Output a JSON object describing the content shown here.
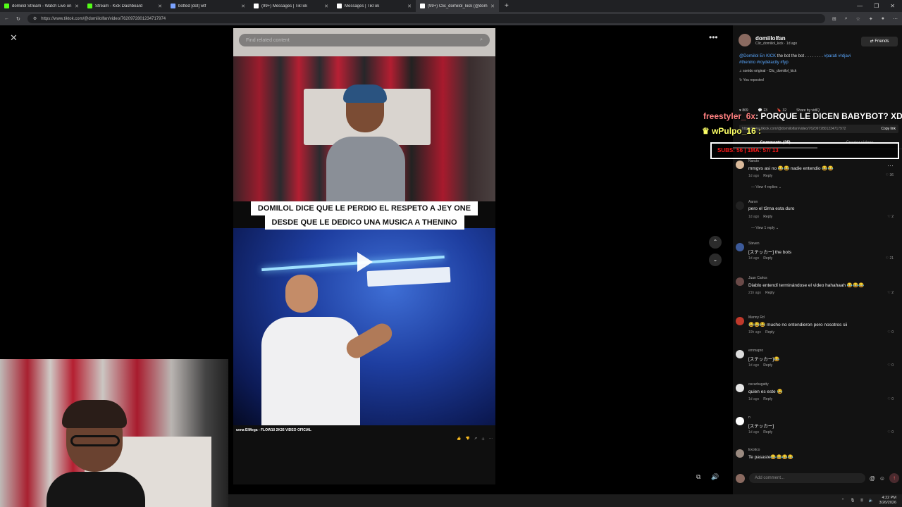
{
  "browser": {
    "tabs": [
      {
        "title": "domiilol Stream - Watch Live on",
        "color": "#53fc18",
        "active": false
      },
      {
        "title": "Stream - Kick Dashboard",
        "color": "#53fc18",
        "active": false
      },
      {
        "title": "botted [dot] wtf",
        "color": "#7aa2ff",
        "active": false
      },
      {
        "title": "(99+) Messages | TikTok",
        "color": "#ffffff",
        "active": false
      },
      {
        "title": "Messages | TikTok",
        "color": "#ffffff",
        "active": false
      },
      {
        "title": "(99+) Clic_domiilol_kick (@domii",
        "color": "#ffffff",
        "active": true
      }
    ],
    "url": "https://www.tiktok.com/@domiilolfan/video/7620972801234717974"
  },
  "video": {
    "search_placeholder": "Find related content",
    "caption_line1": "DOMILOL DICE QUE LE PERDIO EL RESPETO A JEY ONE",
    "caption_line2": "DESDE QUE LE DEDICO UNA MUSICA A THENINO",
    "clip_title": "uena ElMega - FLOW10 2K26 VIDEO OFICIAL"
  },
  "author": {
    "name": "domiilolfan",
    "handle": "Clic_domiilol_kick",
    "age": "1d ago",
    "follow_label": "Friends"
  },
  "post": {
    "mention": "@Domiilol En KICK",
    "text": " the bot the bot . . . . . . . . ",
    "tags1": "#parati #rdjavi",
    "tags2": "#thenino #roydelacity #fyp",
    "sound": "sonido original - Clic_domiilol_kick",
    "reposted": "You reposted",
    "likes": "869",
    "comments": "23",
    "saves": "32",
    "share_by": "Share by vidIQ",
    "link": "https://www.tiktok.com/@domiilolfan/video/7620972801234717972",
    "copy_label": "Copy link"
  },
  "overlay": {
    "chat_user": "freestyler_6x",
    "chat_text": ": PORQUE LE DICEN BABYBOT? XD",
    "chat_user2": "wPulpo_16",
    "chat_text2": ":",
    "banner": "SUBS: 56 | 1MA: 57/ 13"
  },
  "panel_tabs": {
    "comments": "Comments (25)",
    "creator": "Creator videos"
  },
  "comments": [
    {
      "user": "Naruto",
      "text": "mmgvs asi no 😂😂 nadie entendio 😂😂",
      "time": "1d ago",
      "likes": "36",
      "replies": "View 4 replies",
      "avatar": "#d9b99a"
    },
    {
      "user": "Aaron",
      "text": "pero el t3rna esta duro",
      "time": "1d ago",
      "likes": "2",
      "replies": "View 1 reply",
      "avatar": "#222222"
    },
    {
      "user": "Steven",
      "text": "[ステッカー] the bots",
      "time": "1d ago",
      "likes": "21",
      "replies": "",
      "avatar": "#3c5a9a"
    },
    {
      "user": "Juan Carlos",
      "text": "Diablo entendí terminándose el video hahahaah 😂😂😂",
      "time": "21h ago",
      "likes": "2",
      "replies": "",
      "avatar": "#6a4a48"
    },
    {
      "user": "Manny Rd",
      "text": "😂😂😂 mucho no entendieron pero nosotros sii",
      "time": "19h ago",
      "likes": "0",
      "replies": "",
      "avatar": "#c0392b"
    },
    {
      "user": "emmapro",
      "text": "[ステッカー]😂",
      "time": "1d ago",
      "likes": "0",
      "replies": "",
      "avatar": "#dddddd"
    },
    {
      "user": "oscarbugatty",
      "text": "quien es este 😂",
      "time": "1d ago",
      "likes": "0",
      "replies": "",
      "avatar": "#e6e6e6"
    },
    {
      "user": "n",
      "text": "[ステッカー]",
      "time": "1d ago",
      "likes": "0",
      "replies": "",
      "avatar": "#ffffff"
    },
    {
      "user": "Exotico",
      "text": "Te pasaste😂😂😂😂",
      "time": "",
      "likes": "",
      "replies": "",
      "avatar": "#9a8a80"
    }
  ],
  "reply_label": "Reply",
  "composer": {
    "placeholder": "Add comment..."
  },
  "clock": {
    "time": "4:22 PM",
    "date": "3/26/2026"
  }
}
